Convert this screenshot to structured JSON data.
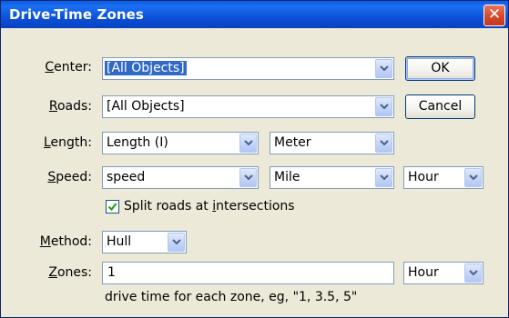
{
  "window": {
    "title": "Drive-Time Zones",
    "close_glyph": "✕"
  },
  "center": {
    "label_key": "C",
    "label_rest": "enter:",
    "value": "[All Objects]"
  },
  "roads": {
    "label_key": "R",
    "label_rest": "oads:",
    "value": "[All Objects]"
  },
  "length": {
    "label_key": "L",
    "label_rest": "ength:",
    "value": "Length (I)",
    "unit": "Meter"
  },
  "speed": {
    "label_key": "S",
    "label_rest": "peed:",
    "value": "speed",
    "unit": "Mile",
    "time_unit": "Hour"
  },
  "split": {
    "checked": true,
    "label_pre": "Split roads at ",
    "label_key": "i",
    "label_post": "ntersections"
  },
  "method": {
    "label_key": "M",
    "label_rest": "ethod:",
    "value": "Hull"
  },
  "zones": {
    "label_key": "Z",
    "label_rest": "ones:",
    "value": "1",
    "unit": "Hour",
    "hint": "drive time for each zone, eg, \"1, 3.5, 5\""
  },
  "buttons": {
    "ok": "OK",
    "cancel": "Cancel"
  },
  "icons": {
    "dropdown": "chevron-down-icon",
    "check": "checkmark-icon",
    "close": "close-icon"
  },
  "colors": {
    "title_bar": "#0a5ee8",
    "selection": "#316ac5",
    "dialog_bg": "#ece9d8",
    "close_button": "#d2462a"
  }
}
